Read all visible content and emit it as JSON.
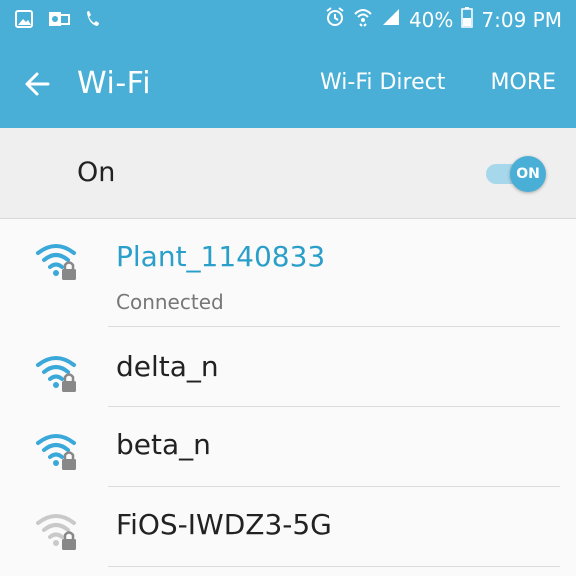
{
  "status_bar": {
    "battery": "40%",
    "time": "7:09 PM",
    "left_icons": [
      "gallery-icon",
      "outlook-icon",
      "missed-call-icon"
    ],
    "right_icons": [
      "alarm-icon",
      "wifi-status-icon",
      "signal-icon",
      "battery-icon"
    ]
  },
  "app_bar": {
    "title": "Wi-Fi",
    "wifi_direct": "Wi-Fi Direct",
    "more": "MORE"
  },
  "toggle": {
    "label": "On",
    "switch_label": "ON",
    "state": true
  },
  "networks": [
    {
      "name": "Plant_1140833",
      "status": "Connected",
      "secured": true,
      "connected": true
    },
    {
      "name": "delta_n",
      "secured": true
    },
    {
      "name": "beta_n",
      "secured": true
    },
    {
      "name": "FiOS-IWDZ3-5G",
      "secured": true,
      "weak": true
    }
  ],
  "colors": {
    "accent": "#4aafd6",
    "connected_text": "#2a9fc9",
    "wifi_strong": "#3aa8d8",
    "wifi_weak": "#c9c9c9"
  }
}
